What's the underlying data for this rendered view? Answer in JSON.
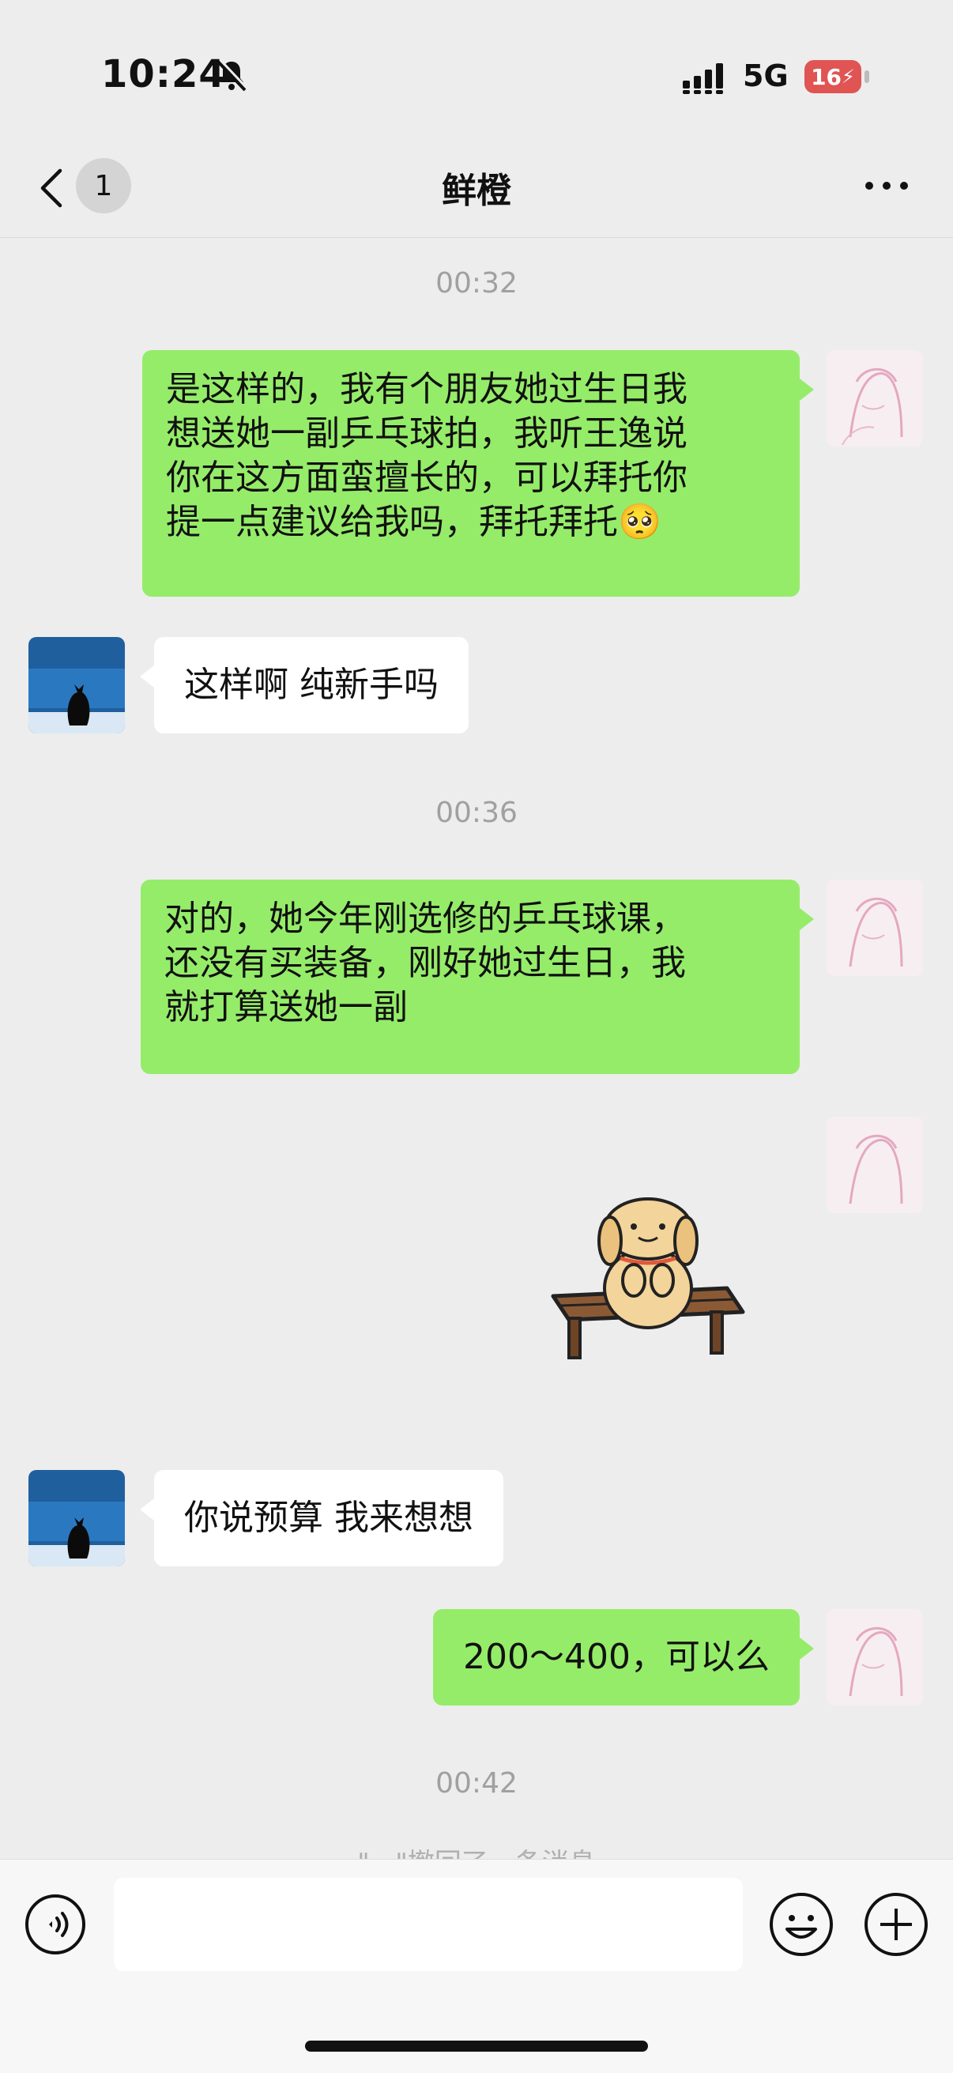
{
  "status_bar": {
    "time": "10:24",
    "network": "5G",
    "battery": "16"
  },
  "nav": {
    "unread_count": "1",
    "title": "鲜橙"
  },
  "messages": [
    {
      "type": "timestamp",
      "text": "00:32"
    },
    {
      "type": "sent",
      "lines": [
        "是这样的，我有个朋友她过生日我",
        "想送她一副乒乓球拍，我听王逸说",
        "你在这方面蛮擅长的，可以拜托你",
        "提一点建议给我吗，拜托拜托🥺"
      ]
    },
    {
      "type": "received",
      "text": "这样啊 纯新手吗"
    },
    {
      "type": "timestamp",
      "text": "00:36"
    },
    {
      "type": "sent",
      "lines": [
        "对的，她今年刚选修的乒乓球课，",
        "还没有买装备，刚好她过生日，我",
        "就打算送她一副"
      ]
    },
    {
      "type": "sent_sticker",
      "sticker": "dog-on-bench-sticker"
    },
    {
      "type": "received",
      "text": "你说预算 我来想想"
    },
    {
      "type": "sent",
      "text": "200～400，可以么"
    },
    {
      "type": "timestamp",
      "text": "00:42"
    },
    {
      "type": "recall",
      "text": "\"...\"撤回了一条消息"
    }
  ],
  "input": {
    "placeholder": ""
  },
  "icons": {
    "back": "chevron-left-icon",
    "more": "more-dots-icon",
    "voice": "voice-icon",
    "emoji": "emoji-icon",
    "add": "plus-icon"
  },
  "colors": {
    "sent_bubble": "#95ec69",
    "received_bubble": "#ffffff",
    "background": "#ededed",
    "battery_low": "#e05454"
  }
}
